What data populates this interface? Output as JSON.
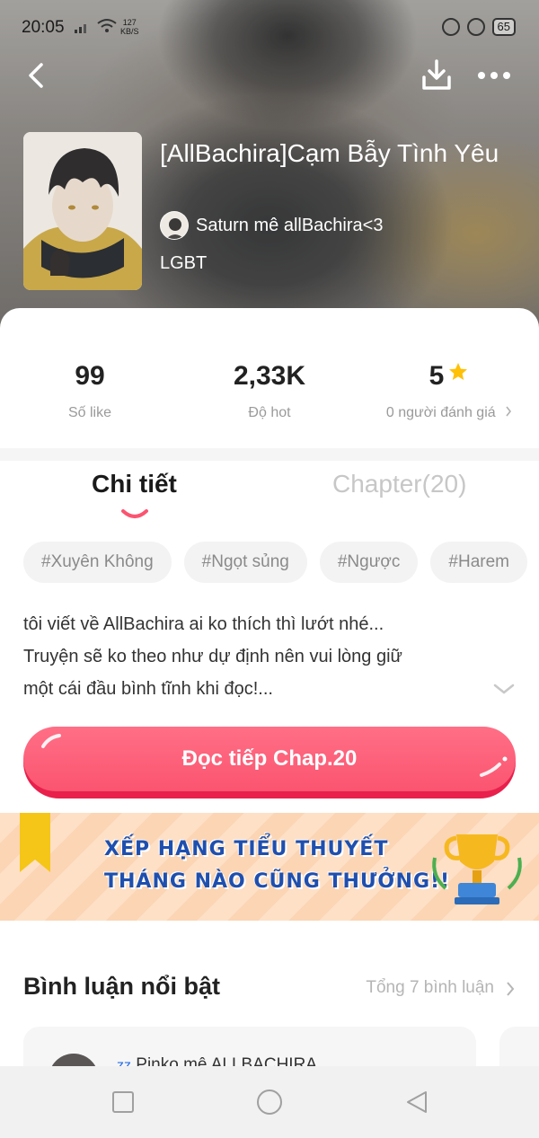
{
  "status_bar": {
    "time": "20:05",
    "network_speed_value": "127",
    "network_speed_unit": "KB/S",
    "battery": "65"
  },
  "nav": {
    "back_icon": "chevron-left-icon",
    "download_icon": "download-icon",
    "more_icon": "more-dots-icon"
  },
  "book": {
    "title": "[AllBachira]Cạm Bẫy Tình Yêu",
    "author": "Saturn mê allBachira<3",
    "genre": "LGBT"
  },
  "stats": [
    {
      "value": "99",
      "label": "Số like"
    },
    {
      "value": "2,33K",
      "label": "Độ hot"
    },
    {
      "value": "5",
      "label": "0 người đánh giá"
    }
  ],
  "tabs": {
    "detail": "Chi tiết",
    "chapters": "Chapter(20)"
  },
  "tags": [
    "#Xuyên Không",
    "#Ngọt sủng",
    "#Ngược",
    "#Harem"
  ],
  "description": {
    "line1": "tôi viết về AllBachira ai ko thích thì lướt nhé...",
    "line2": "Truyện sẽ ko theo như dự định nên vui lòng giữ",
    "line3": "một cái đầu bình tĩnh khi đọc!..."
  },
  "read_button": {
    "label": "Đọc tiếp Chap.20"
  },
  "banner": {
    "line1": "XẾP HẠNG TIỂU THUYẾT",
    "line2": "THÁNG NÀO CŨNG THƯỞNG!!"
  },
  "comments": {
    "title": "Bình luận nổi bật",
    "total": "Tổng 7 bình luận",
    "first_user": "Pinko mê ALLBACHIRA"
  },
  "colors": {
    "accent": "#fb5470",
    "star": "#ffc107",
    "banner_text": "#1f4fae"
  }
}
